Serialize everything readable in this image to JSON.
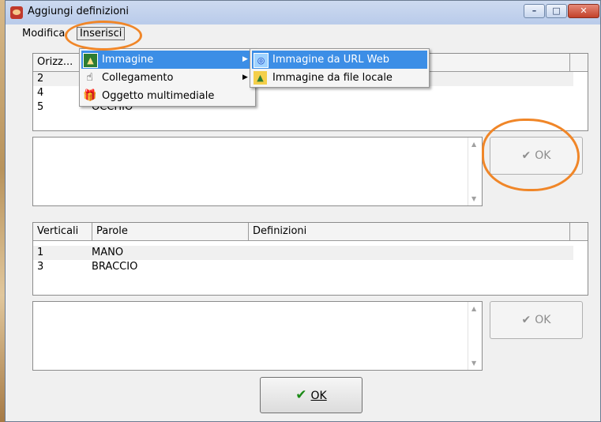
{
  "window": {
    "title": "Aggiungi definizioni"
  },
  "menubar": {
    "modifica": "Modifica",
    "inserisci": "Inserisci"
  },
  "menu_inserisci": {
    "items": [
      {
        "label": "Immagine",
        "icon": "image-icon",
        "has_submenu": true
      },
      {
        "label": "Collegamento",
        "icon": "hand-pointer-icon",
        "has_submenu": true
      },
      {
        "label": "Oggetto multimediale",
        "icon": "gift-icon",
        "has_submenu": false
      }
    ]
  },
  "submenu_immagine": {
    "items": [
      {
        "label": "Immagine da URL Web",
        "icon": "web-image-icon"
      },
      {
        "label": "Immagine da file locale",
        "icon": "folder-image-icon"
      }
    ]
  },
  "orizzontali": {
    "columns": [
      "Orizz..."
    ],
    "rows": [
      {
        "num": "2",
        "parola": ""
      },
      {
        "num": "4",
        "parola": ""
      },
      {
        "num": "5",
        "parola": "OCCHIO"
      }
    ]
  },
  "verticali": {
    "columns": [
      "Verticali",
      "Parole",
      "Definizioni"
    ],
    "rows": [
      {
        "num": "1",
        "parola": "MANO"
      },
      {
        "num": "3",
        "parola": "BRACCIO"
      }
    ]
  },
  "buttons": {
    "ok_small": "OK",
    "ok_main": "OK"
  },
  "colors": {
    "highlight": "#3c8ee6",
    "annotation": "#f08628",
    "ok_check": "#1b8a16"
  }
}
